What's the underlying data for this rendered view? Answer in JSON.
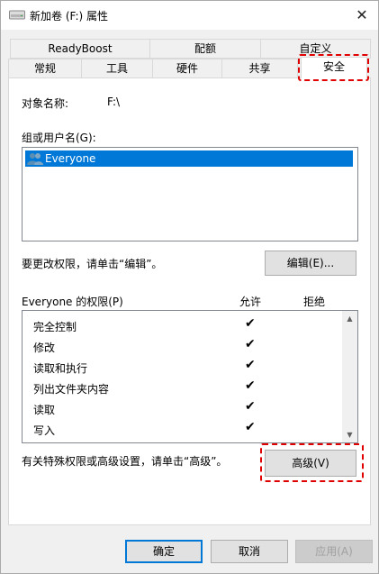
{
  "window": {
    "title": "新加卷 (F:) 属性",
    "close": "✕"
  },
  "tabs_back": [
    "ReadyBoost",
    "配额",
    "自定义"
  ],
  "tabs_front": [
    "常规",
    "工具",
    "硬件",
    "共享",
    "安全"
  ],
  "security": {
    "object_name_label": "对象名称:",
    "object_name_value": "F:\\",
    "group_label": "组或用户名(G):",
    "users": [
      "Everyone"
    ],
    "change_text": "要更改权限，请单击“编辑”。",
    "edit_button": "编辑(E)...",
    "perm_header": "Everyone 的权限(P)",
    "allow_header": "允许",
    "deny_header": "拒绝",
    "permissions": [
      {
        "name": "完全控制",
        "allow": "✔"
      },
      {
        "name": "修改",
        "allow": "✔"
      },
      {
        "name": "读取和执行",
        "allow": "✔"
      },
      {
        "name": "列出文件夹内容",
        "allow": "✔"
      },
      {
        "name": "读取",
        "allow": "✔"
      },
      {
        "name": "写入",
        "allow": "✔"
      }
    ],
    "advanced_text": "有关特殊权限或高级设置，请单击“高级”。",
    "advanced_button": "高级(V)"
  },
  "footer": {
    "ok": "确定",
    "cancel": "取消",
    "apply": "应用(A)"
  },
  "colors": {
    "highlight": "#e00000",
    "selection": "#0078d7"
  }
}
